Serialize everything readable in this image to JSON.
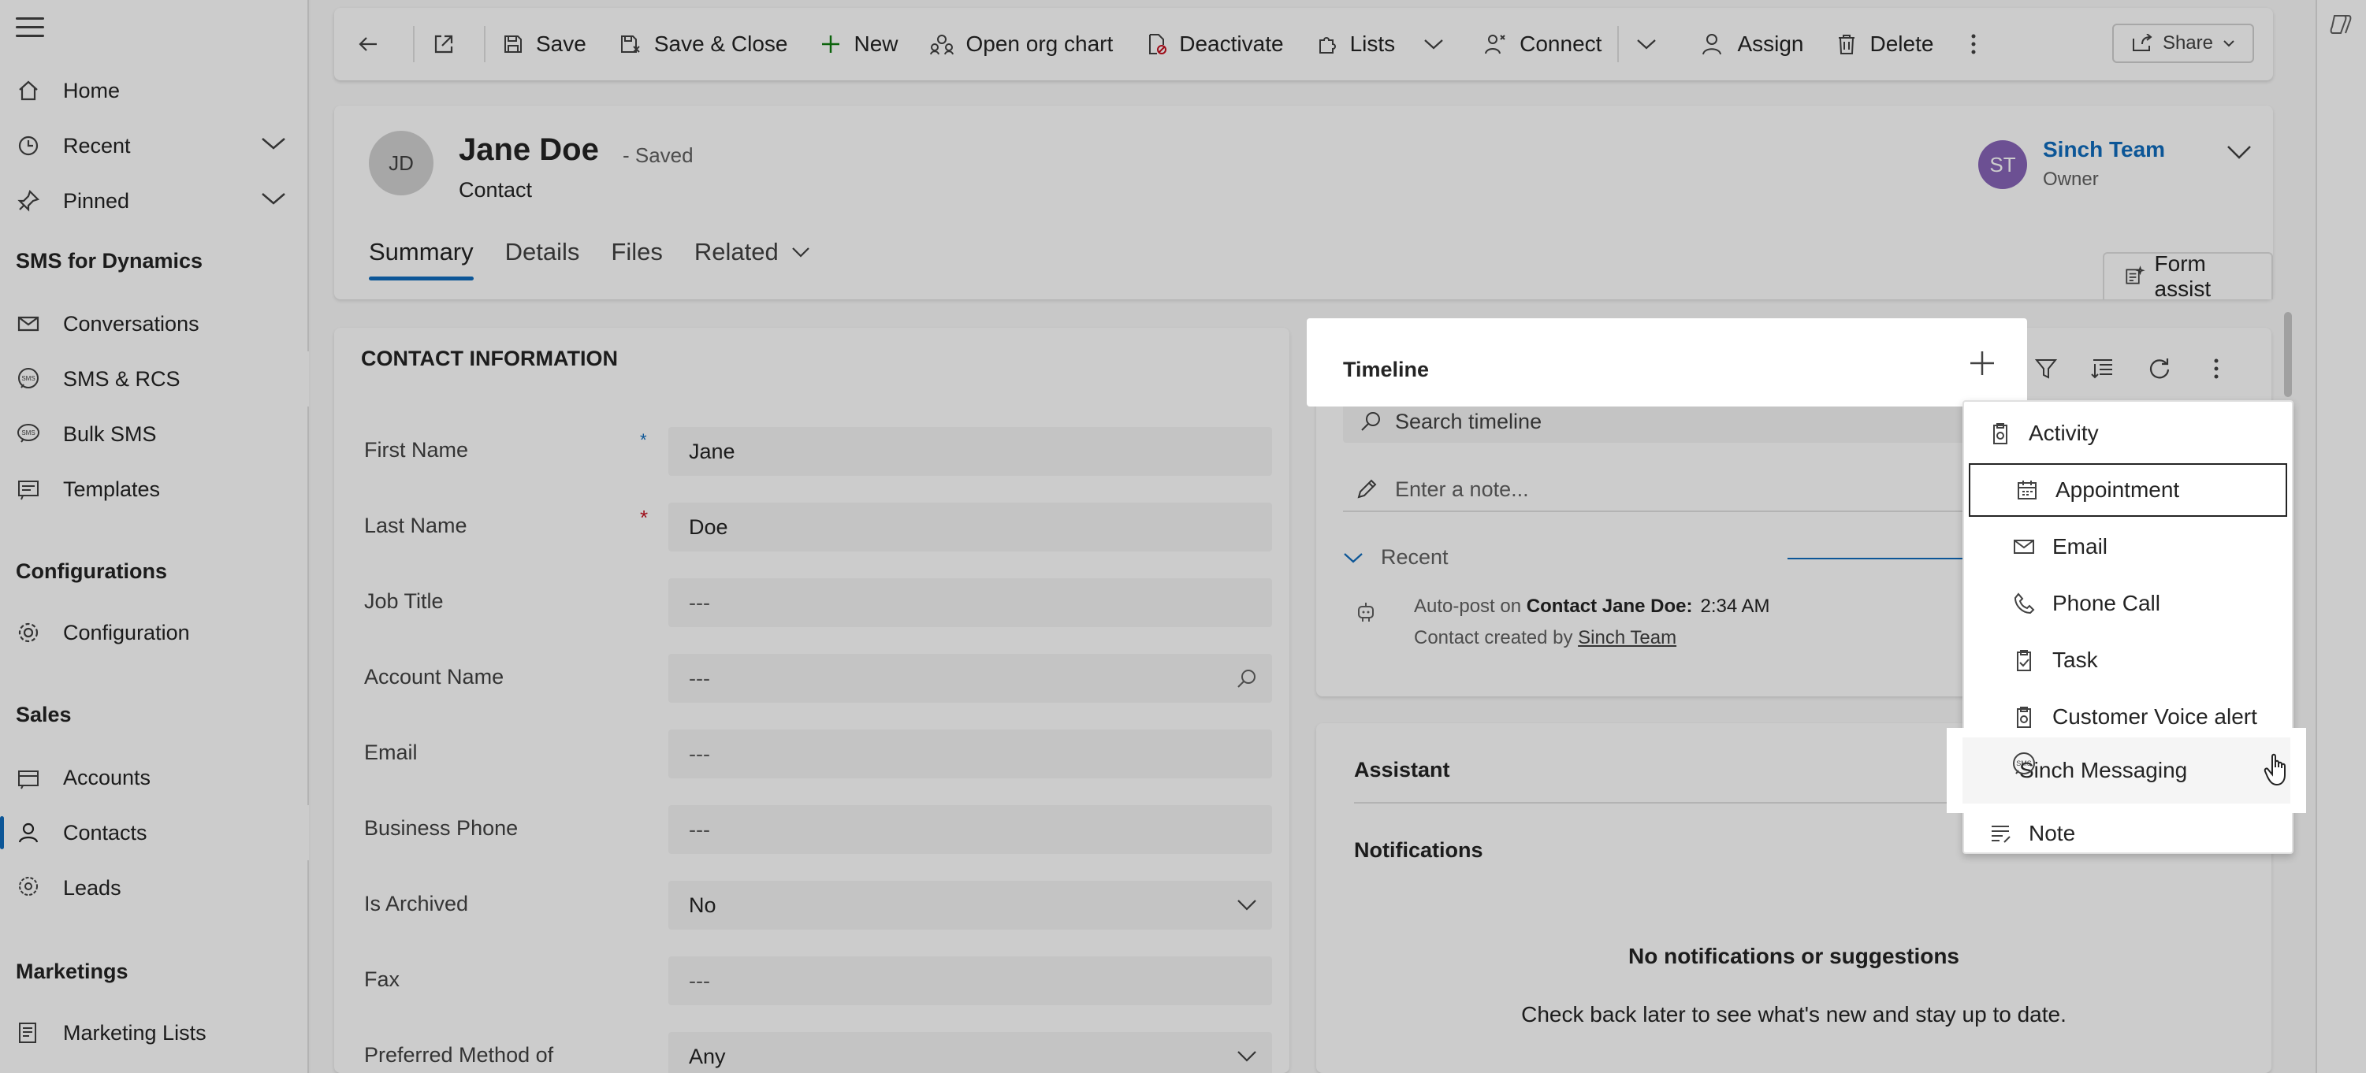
{
  "sidebar": {
    "items": [
      {
        "label": "Home"
      },
      {
        "label": "Recent"
      },
      {
        "label": "Pinned"
      }
    ],
    "sections": [
      {
        "title": "SMS for Dynamics",
        "items": [
          {
            "label": "Conversations"
          },
          {
            "label": "SMS & RCS"
          },
          {
            "label": "Bulk SMS"
          },
          {
            "label": "Templates"
          }
        ]
      },
      {
        "title": "Configurations",
        "items": [
          {
            "label": "Configuration"
          }
        ]
      },
      {
        "title": "Sales",
        "items": [
          {
            "label": "Accounts"
          },
          {
            "label": "Contacts"
          },
          {
            "label": "Leads"
          }
        ]
      },
      {
        "title": "Marketings",
        "items": [
          {
            "label": "Marketing Lists"
          }
        ]
      }
    ]
  },
  "commands": {
    "save": "Save",
    "save_close": "Save & Close",
    "new": "New",
    "org_chart": "Open org chart",
    "deactivate": "Deactivate",
    "lists": "Lists",
    "connect": "Connect",
    "assign": "Assign",
    "delete": "Delete",
    "share": "Share"
  },
  "record": {
    "initials": "JD",
    "name": "Jane Doe",
    "status": "- Saved",
    "type": "Contact",
    "owner_initials": "ST",
    "owner_name": "Sinch Team",
    "owner_role": "Owner",
    "form_assist": "Form assist"
  },
  "tabs": [
    "Summary",
    "Details",
    "Files",
    "Related"
  ],
  "contact_info": {
    "title": "CONTACT INFORMATION",
    "fields": [
      {
        "label": "First Name",
        "required": "*",
        "value": "Jane"
      },
      {
        "label": "Last Name",
        "required": "*",
        "value": "Doe"
      },
      {
        "label": "Job Title",
        "value": "---"
      },
      {
        "label": "Account Name",
        "value": "---"
      },
      {
        "label": "Email",
        "value": "---"
      },
      {
        "label": "Business Phone",
        "value": "---"
      },
      {
        "label": "Is Archived",
        "value": "No"
      },
      {
        "label": "Fax",
        "value": "---"
      },
      {
        "label": "Preferred Method of",
        "value": "Any"
      }
    ]
  },
  "timeline": {
    "title": "Timeline",
    "search_placeholder": "Search timeline",
    "note_placeholder": "Enter a note...",
    "recent_label": "Recent",
    "entry": {
      "prefix": "Auto-post on",
      "subject": "Contact Jane Doe:",
      "time": "2:34 AM",
      "line2_prefix": "Contact created by",
      "line2_link": "Sinch Team"
    }
  },
  "assistant": {
    "title": "Assistant",
    "notifications": "Notifications",
    "empty_title": "No notifications or suggestions",
    "empty_body": "Check back later to see what's new and stay up to date."
  },
  "menu": {
    "activity": "Activity",
    "items": [
      "Appointment",
      "Email",
      "Phone Call",
      "Task",
      "Customer Voice alert",
      "Sinch Messaging"
    ],
    "note": "Note"
  },
  "colors": {
    "accent": "#0f6cbd",
    "owner_avatar": "#8764b8",
    "required": "#c50f1f"
  }
}
